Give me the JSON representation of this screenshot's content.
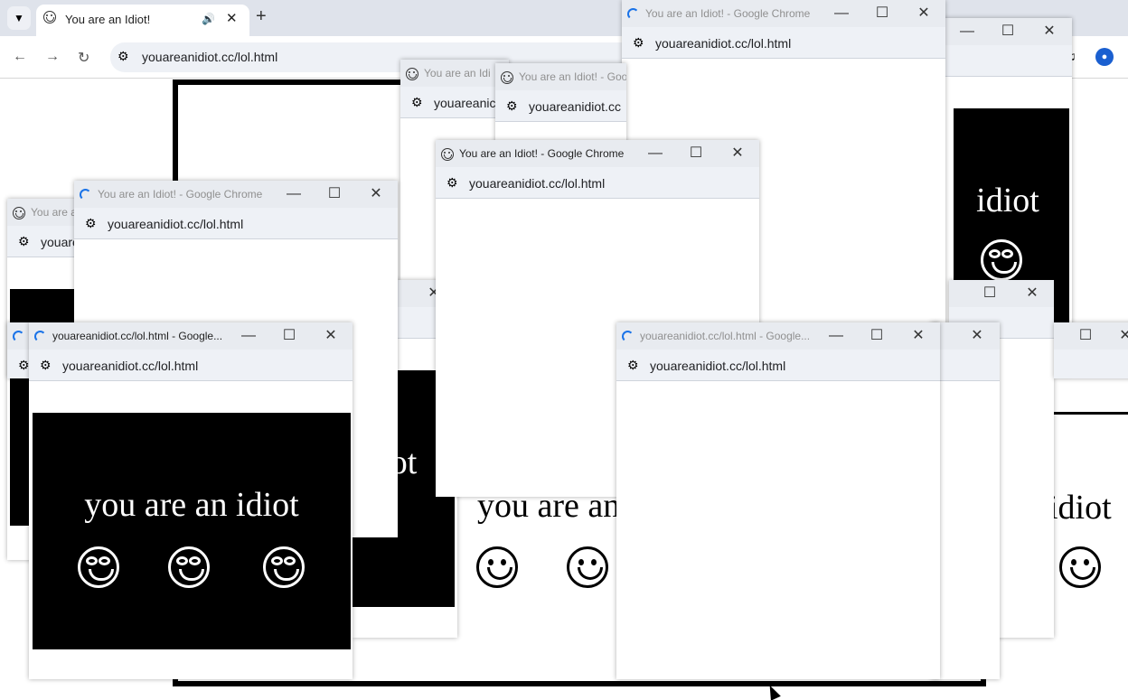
{
  "background_browser": {
    "tab_title": "You are an Idiot!",
    "speaker_icon": "speaker-icon",
    "close_glyph": "✕",
    "new_tab_glyph": "+",
    "url": "youareanidiot.cc/lol.html",
    "page_text_left": "you are an",
    "page_text_right": "idiot"
  },
  "window_controls": {
    "minimize": "—",
    "maximize": "☐",
    "close": "✕"
  },
  "windows": {
    "w1": {
      "title": "You are an Idiot! - Google Chrome",
      "url": "youareanidiot.cc/lol.html"
    },
    "w2": {
      "title": "You are an Idi",
      "url": "youareanic"
    },
    "w3": {
      "title": "You are an Idiot! - Goo",
      "url": "youareanidiot.cc"
    },
    "w4": {
      "title": "You are an Idiot! - Google Chrome",
      "url": "youareanidiot.cc/lol.html"
    },
    "w5": {
      "title": "You are an Idiot! - Google Chrome",
      "url": "youareanidiot.cc/lol.html"
    },
    "w6": {
      "title": "You are a",
      "url": "youare"
    },
    "w7": {
      "title": "youareanidiot.cc/lol.html - Google...",
      "url": "youareanidiot.cc/lol.html",
      "panel_text": "you are an idiot"
    },
    "w8": {
      "title": "youareanidiot.cc/lol.html - Google...",
      "url": "youareanidiot.cc/lol.html"
    },
    "w9": {
      "panel_text": "idiot"
    },
    "w10": {
      "panel_text": "ot"
    }
  },
  "colors": {
    "accent": "#1a73e8",
    "titlebar": "#e8ebf0",
    "addressbar": "#eef1f6",
    "panel": "#000000"
  }
}
